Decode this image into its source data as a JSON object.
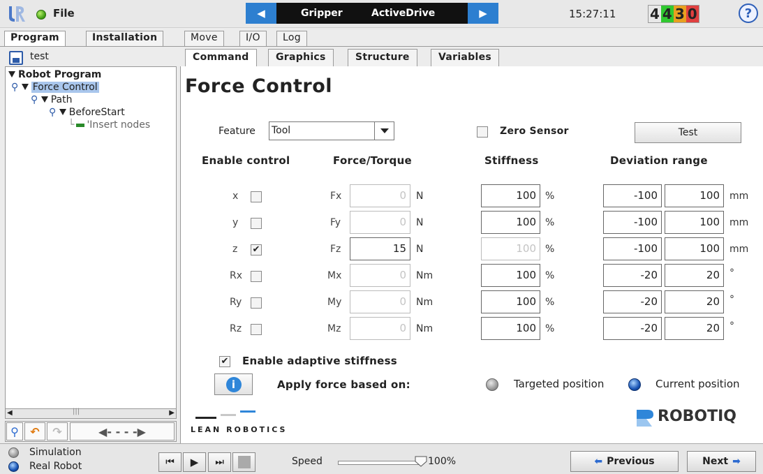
{
  "topbar": {
    "file_label": "File",
    "program_nav_title": "Gripper",
    "program_nav_subtitle": "ActiveDrive",
    "clock": "15:27:11",
    "robot_id_digits": [
      "4",
      "4",
      "3",
      "0"
    ],
    "robot_id_colors": [
      "#e8e8e8",
      "#30c830",
      "#e8a020",
      "#e04040"
    ],
    "help_label": "?"
  },
  "main_tabs": [
    "Program",
    "Installation",
    "Move",
    "I/O",
    "Log"
  ],
  "left_panel": {
    "program_name": "test",
    "tree": [
      {
        "label": "Robot Program"
      },
      {
        "label": "Force Control"
      },
      {
        "label": "Path"
      },
      {
        "label": "BeforeStart"
      },
      {
        "label": "'Insert nodes"
      }
    ]
  },
  "sub_tabs": [
    "Command",
    "Graphics",
    "Structure",
    "Variables"
  ],
  "force_control": {
    "title": "Force Control",
    "feature_label": "Feature",
    "feature_value": "Tool",
    "zero_sensor_label": "Zero Sensor",
    "test_button": "Test",
    "headers": {
      "enable": "Enable control",
      "force": "Force/Torque",
      "stiffness": "Stiffness",
      "deviation": "Deviation range"
    },
    "rows": [
      {
        "axis": "x",
        "checked": "",
        "ft_label": "Fx",
        "ft_value": "0",
        "ft_unit": "N",
        "stiffness": "100",
        "stiff_unit": "%",
        "dev_min": "-100",
        "dev_max": "100",
        "dev_unit": "mm"
      },
      {
        "axis": "y",
        "checked": "",
        "ft_label": "Fy",
        "ft_value": "0",
        "ft_unit": "N",
        "stiffness": "100",
        "stiff_unit": "%",
        "dev_min": "-100",
        "dev_max": "100",
        "dev_unit": "mm"
      },
      {
        "axis": "z",
        "checked": "✔",
        "ft_label": "Fz",
        "ft_value": "15",
        "ft_unit": "N",
        "stiffness": "100",
        "stiff_unit": "%",
        "dev_min": "-100",
        "dev_max": "100",
        "dev_unit": "mm"
      },
      {
        "axis": "Rx",
        "checked": "",
        "ft_label": "Mx",
        "ft_value": "0",
        "ft_unit": "Nm",
        "stiffness": "100",
        "stiff_unit": "%",
        "dev_min": "-20",
        "dev_max": "20",
        "dev_unit": "°"
      },
      {
        "axis": "Ry",
        "checked": "",
        "ft_label": "My",
        "ft_value": "0",
        "ft_unit": "Nm",
        "stiffness": "100",
        "stiff_unit": "%",
        "dev_min": "-20",
        "dev_max": "20",
        "dev_unit": "°"
      },
      {
        "axis": "Rz",
        "checked": "",
        "ft_label": "Mz",
        "ft_value": "0",
        "ft_unit": "Nm",
        "stiffness": "100",
        "stiff_unit": "%",
        "dev_min": "-20",
        "dev_max": "20",
        "dev_unit": "°"
      }
    ],
    "adaptive_checked": "✔",
    "adaptive_label": "Enable adaptive stiffness",
    "info_label": "i",
    "apply_label": "Apply force based on:",
    "option_targeted": "Targeted position",
    "option_current": "Current position",
    "lean_logo": "LEAN ROBOTICS",
    "robotiq_logo": "ROBOTIQ"
  },
  "bottombar": {
    "simulation": "Simulation",
    "real_robot": "Real Robot",
    "speed_label": "Speed",
    "speed_value": "100%",
    "previous": "Previous",
    "next": "Next"
  }
}
